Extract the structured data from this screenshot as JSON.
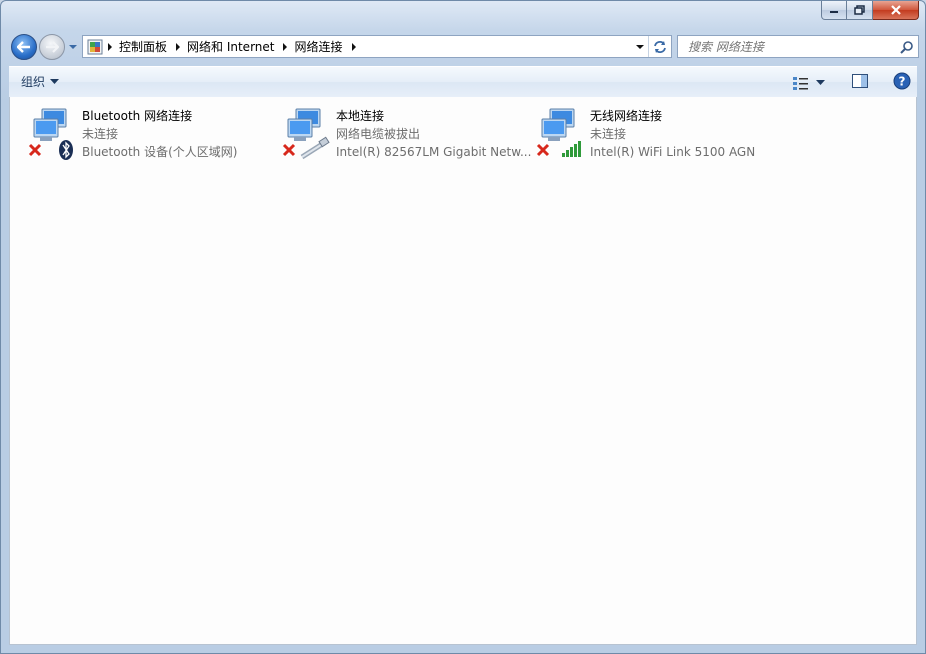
{
  "window": {
    "controls": [
      "minimize",
      "maximize",
      "close"
    ]
  },
  "navigation": {
    "breadcrumbs": [
      "控制面板",
      "网络和 Internet",
      "网络连接"
    ],
    "search_placeholder": "搜索 网络连接"
  },
  "toolbar": {
    "organize_label": "组织"
  },
  "connections": [
    {
      "name": "Bluetooth 网络连接",
      "status": "未连接",
      "device": "Bluetooth 设备(个人区域网)",
      "badge_icon": "bluetooth-icon",
      "state_icon": "disconnected-x-icon"
    },
    {
      "name": "本地连接",
      "status": "网络电缆被拔出",
      "device": "Intel(R) 82567LM Gigabit Netw...",
      "badge_icon": "ethernet-cable-icon",
      "state_icon": "disconnected-x-icon"
    },
    {
      "name": "无线网络连接",
      "status": "未连接",
      "device": "Intel(R) WiFi Link 5100 AGN",
      "badge_icon": "wifi-signal-icon",
      "state_icon": "disconnected-x-icon"
    }
  ],
  "colors": {
    "disconnected_red": "#d7281c",
    "wifi_green": "#2f9a3a",
    "accent_blue": "#2a6fc9"
  }
}
